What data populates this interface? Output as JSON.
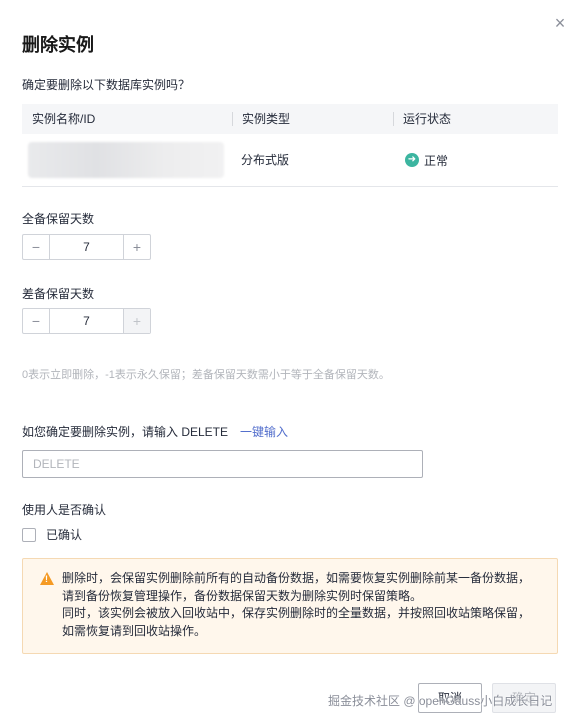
{
  "dialog": {
    "title": "删除实例",
    "close_symbol": "×",
    "question": "确定要删除以下数据库实例吗？"
  },
  "table": {
    "headers": [
      "实例名称/ID",
      "实例类型",
      "运行状态"
    ],
    "rows": [
      {
        "type": "分布式版",
        "status": "正常",
        "status_icon": "check-circle-icon",
        "status_color": "#3cb5a0"
      }
    ]
  },
  "full_backup": {
    "label": "全备保留天数",
    "value": "7",
    "minus": "−",
    "plus": "+"
  },
  "diff_backup": {
    "label": "差备保留天数",
    "value": "7",
    "minus": "−",
    "plus": "+"
  },
  "hint": "0表示立即删除，-1表示永久保留；差备保留天数需小于等于全备保留天数。",
  "confirm": {
    "text": "如您确定要删除实例，请输入 DELETE",
    "link": "一键输入",
    "placeholder": "DELETE"
  },
  "user_confirm": {
    "label": "使用人是否确认",
    "checkbox_label": "已确认"
  },
  "alert": {
    "icon": "warning-icon",
    "line1": "删除时，会保留实例删除前所有的自动备份数据，如需要恢复实例删除前某一备份数据，",
    "line2": "请到备份恢复管理操作，备份数据保留天数为删除实例时保留策略。",
    "line3": "同时，该实例会被放入回收站中，保存实例删除时的全量数据，并按照回收站策略保留，",
    "line4": "如需恢复请到回收站操作。"
  },
  "footer": {
    "cancel": "取消",
    "ok": "确定"
  },
  "watermark": "掘金技术社区 @ openGauss小白成长日记",
  "colors": {
    "accent_link": "#526ecc",
    "success": "#3cb5a0",
    "warning": "#f59a23",
    "alert_bg": "#fff7ec"
  }
}
